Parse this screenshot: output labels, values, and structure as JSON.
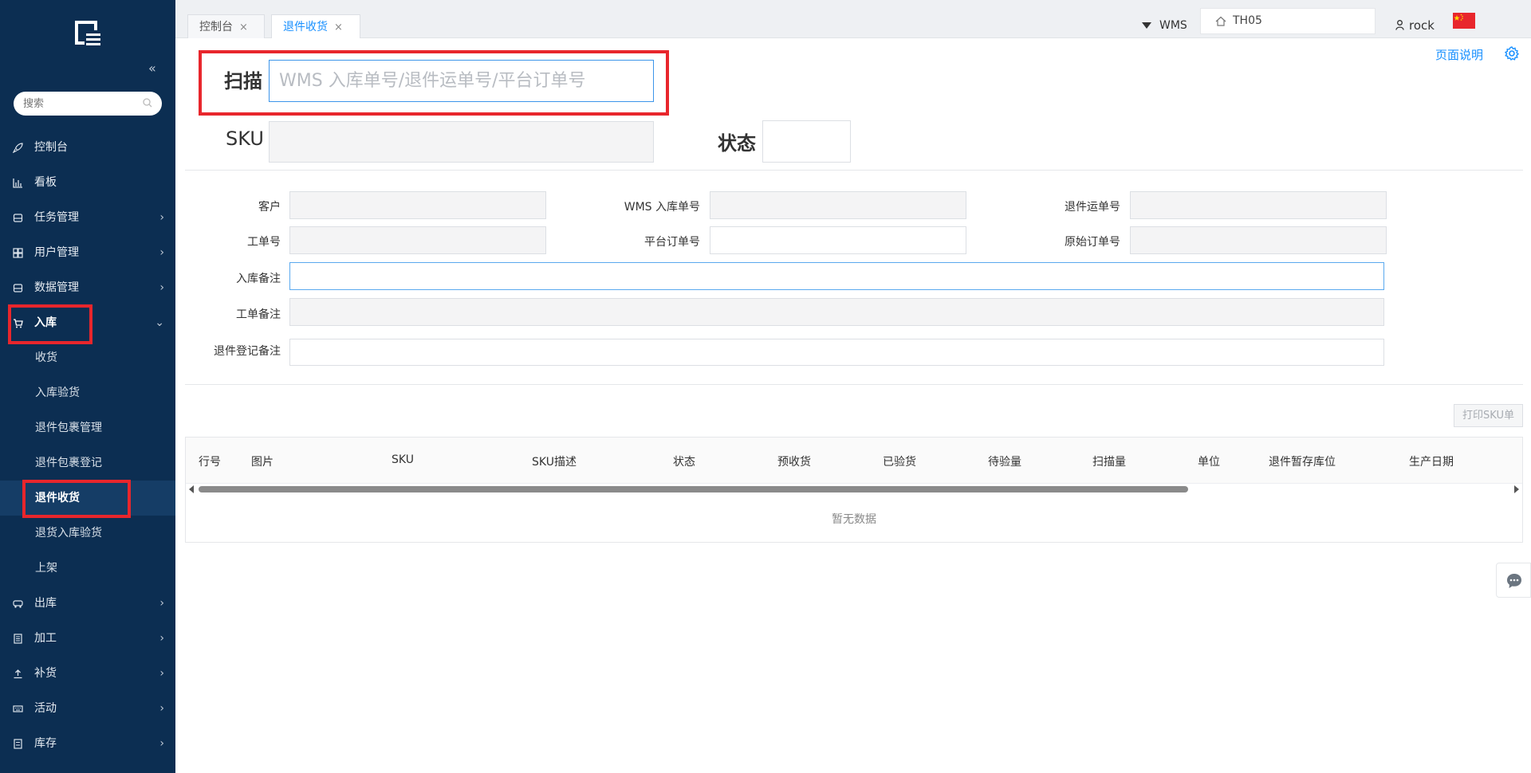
{
  "sidebar": {
    "search_placeholder": "搜索",
    "collapse_glyph": "«",
    "items": [
      {
        "label": "控制台",
        "icon": "rocket-icon"
      },
      {
        "label": "看板",
        "icon": "bar-chart-icon"
      },
      {
        "label": "任务管理",
        "icon": "inbox-icon"
      },
      {
        "label": "用户管理",
        "icon": "users-icon"
      },
      {
        "label": "数据管理",
        "icon": "database-icon"
      },
      {
        "label": "入库",
        "icon": "cart-icon"
      },
      {
        "label": "收货"
      },
      {
        "label": "入库验货"
      },
      {
        "label": "退件包裹管理"
      },
      {
        "label": "退件包裹登记"
      },
      {
        "label": "退件收货"
      },
      {
        "label": "退货入库验货"
      },
      {
        "label": "上架"
      },
      {
        "label": "出库",
        "icon": "truck-icon"
      },
      {
        "label": "加工",
        "icon": "document-icon"
      },
      {
        "label": "补货",
        "icon": "upload-icon"
      },
      {
        "label": "活动",
        "icon": "keyboard-icon"
      },
      {
        "label": "库存",
        "icon": "list-icon"
      }
    ]
  },
  "tabs": [
    {
      "label": "控制台",
      "close": "×"
    },
    {
      "label": "退件收货",
      "close": "×"
    }
  ],
  "topbar": {
    "system": "WMS",
    "warehouse": "TH05",
    "user": "rock"
  },
  "page": {
    "help_link": "页面说明",
    "scan_label": "扫描",
    "scan_placeholder": "WMS 入库单号/退件运单号/平台订单号",
    "sku_label": "SKU",
    "state_label": "状态"
  },
  "form": {
    "customer": "客户",
    "wms_inbound_no": "WMS 入库单号",
    "return_waybill_no": "退件运单号",
    "work_order_no": "工单号",
    "platform_order_no": "平台订单号",
    "original_order_no": "原始订单号",
    "inbound_remark": "入库备注",
    "work_order_remark": "工单备注",
    "return_register_remark": "退件登记备注"
  },
  "toolbar": {
    "print_sku": "打印SKU单"
  },
  "table": {
    "columns": [
      "行号",
      "图片",
      "SKU",
      "SKU描述",
      "状态",
      "预收货",
      "已验货",
      "待验量",
      "扫描量",
      "单位",
      "退件暂存库位",
      "生产日期"
    ],
    "empty_text": "暂无数据"
  },
  "colors": {
    "sidebar_bg": "#0c2e52",
    "accent": "#1890ff",
    "highlight": "#e8262c"
  }
}
